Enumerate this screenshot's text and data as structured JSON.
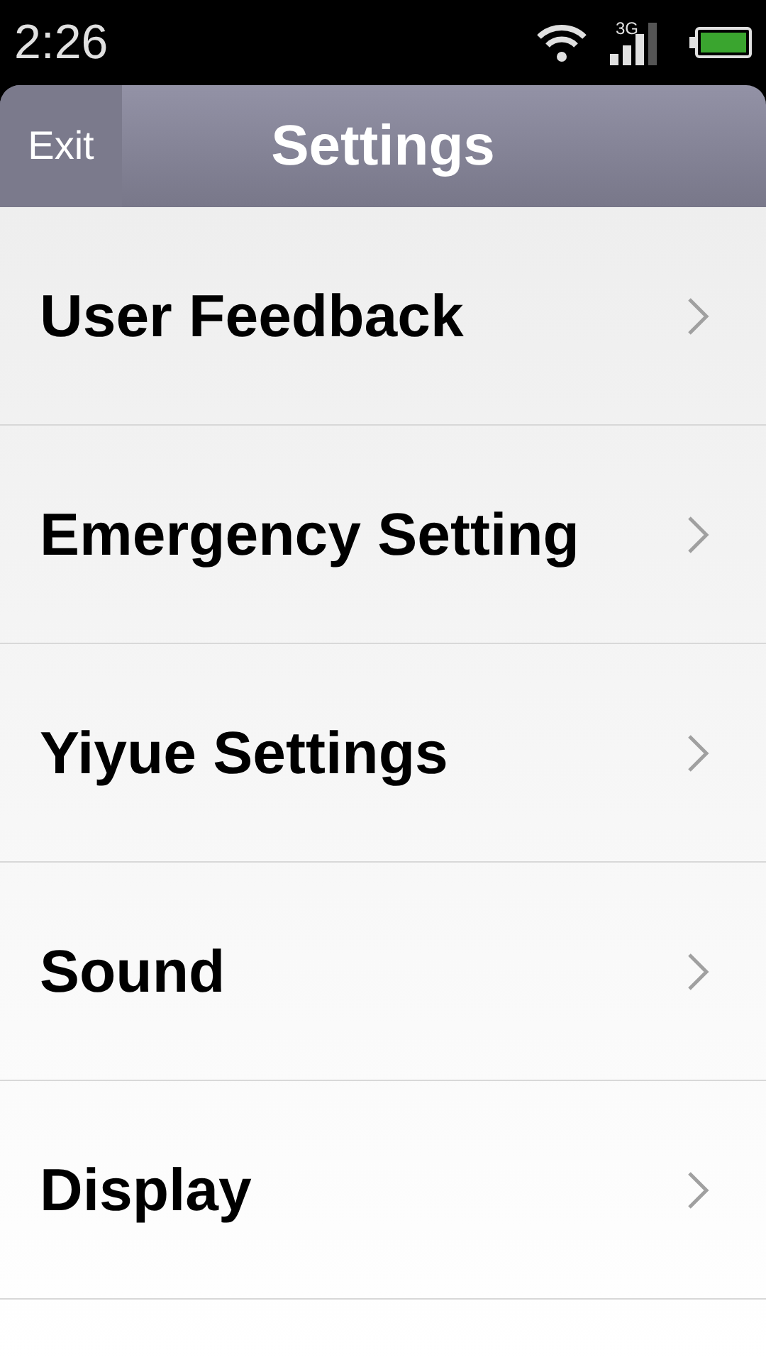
{
  "status_bar": {
    "time": "2:26",
    "network": "3G"
  },
  "header": {
    "back": "Exit",
    "title": "Settings"
  },
  "items": [
    {
      "label": "User Feedback"
    },
    {
      "label": "Emergency Setting"
    },
    {
      "label": "Yiyue Settings"
    },
    {
      "label": "Sound"
    },
    {
      "label": "Display"
    }
  ]
}
